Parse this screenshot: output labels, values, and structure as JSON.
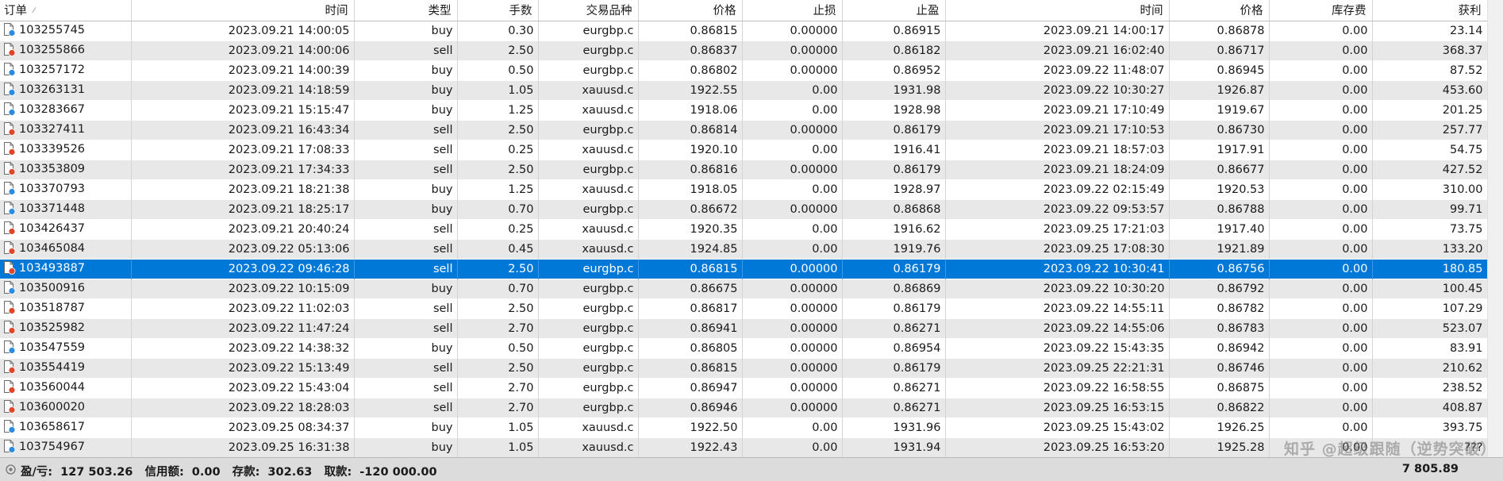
{
  "columns": [
    {
      "key": "order",
      "label": "订单",
      "align": "left",
      "sortable": true
    },
    {
      "key": "open_time",
      "label": "时间",
      "align": "right"
    },
    {
      "key": "type",
      "label": "类型",
      "align": "right"
    },
    {
      "key": "volume",
      "label": "手数",
      "align": "right"
    },
    {
      "key": "symbol",
      "label": "交易品种",
      "align": "right"
    },
    {
      "key": "open_price",
      "label": "价格",
      "align": "right"
    },
    {
      "key": "sl",
      "label": "止损",
      "align": "right"
    },
    {
      "key": "tp",
      "label": "止盈",
      "align": "right"
    },
    {
      "key": "close_time",
      "label": "时间",
      "align": "right"
    },
    {
      "key": "close_price",
      "label": "价格",
      "align": "right"
    },
    {
      "key": "swap",
      "label": "库存费",
      "align": "right"
    },
    {
      "key": "profit",
      "label": "获利",
      "align": "right"
    }
  ],
  "sort_glyph": "⁄",
  "rows": [
    {
      "order": "103255745",
      "open_time": "2023.09.21 14:00:05",
      "type": "buy",
      "volume": "0.30",
      "symbol": "eurgbp.c",
      "open_price": "0.86815",
      "sl": "0.00000",
      "tp": "0.86915",
      "close_time": "2023.09.21 14:00:17",
      "close_price": "0.86878",
      "swap": "0.00",
      "profit": "23.14"
    },
    {
      "order": "103255866",
      "open_time": "2023.09.21 14:00:06",
      "type": "sell",
      "volume": "2.50",
      "symbol": "eurgbp.c",
      "open_price": "0.86837",
      "sl": "0.00000",
      "tp": "0.86182",
      "close_time": "2023.09.21 16:02:40",
      "close_price": "0.86717",
      "swap": "0.00",
      "profit": "368.37"
    },
    {
      "order": "103257172",
      "open_time": "2023.09.21 14:00:39",
      "type": "buy",
      "volume": "0.50",
      "symbol": "eurgbp.c",
      "open_price": "0.86802",
      "sl": "0.00000",
      "tp": "0.86952",
      "close_time": "2023.09.22 11:48:07",
      "close_price": "0.86945",
      "swap": "0.00",
      "profit": "87.52"
    },
    {
      "order": "103263131",
      "open_time": "2023.09.21 14:18:59",
      "type": "buy",
      "volume": "1.05",
      "symbol": "xauusd.c",
      "open_price": "1922.55",
      "sl": "0.00",
      "tp": "1931.98",
      "close_time": "2023.09.22 10:30:27",
      "close_price": "1926.87",
      "swap": "0.00",
      "profit": "453.60"
    },
    {
      "order": "103283667",
      "open_time": "2023.09.21 15:15:47",
      "type": "buy",
      "volume": "1.25",
      "symbol": "xauusd.c",
      "open_price": "1918.06",
      "sl": "0.00",
      "tp": "1928.98",
      "close_time": "2023.09.21 17:10:49",
      "close_price": "1919.67",
      "swap": "0.00",
      "profit": "201.25"
    },
    {
      "order": "103327411",
      "open_time": "2023.09.21 16:43:34",
      "type": "sell",
      "volume": "2.50",
      "symbol": "eurgbp.c",
      "open_price": "0.86814",
      "sl": "0.00000",
      "tp": "0.86179",
      "close_time": "2023.09.21 17:10:53",
      "close_price": "0.86730",
      "swap": "0.00",
      "profit": "257.77"
    },
    {
      "order": "103339526",
      "open_time": "2023.09.21 17:08:33",
      "type": "sell",
      "volume": "0.25",
      "symbol": "xauusd.c",
      "open_price": "1920.10",
      "sl": "0.00",
      "tp": "1916.41",
      "close_time": "2023.09.21 18:57:03",
      "close_price": "1917.91",
      "swap": "0.00",
      "profit": "54.75"
    },
    {
      "order": "103353809",
      "open_time": "2023.09.21 17:34:33",
      "type": "sell",
      "volume": "2.50",
      "symbol": "eurgbp.c",
      "open_price": "0.86816",
      "sl": "0.00000",
      "tp": "0.86179",
      "close_time": "2023.09.21 18:24:09",
      "close_price": "0.86677",
      "swap": "0.00",
      "profit": "427.52"
    },
    {
      "order": "103370793",
      "open_time": "2023.09.21 18:21:38",
      "type": "buy",
      "volume": "1.25",
      "symbol": "xauusd.c",
      "open_price": "1918.05",
      "sl": "0.00",
      "tp": "1928.97",
      "close_time": "2023.09.22 02:15:49",
      "close_price": "1920.53",
      "swap": "0.00",
      "profit": "310.00"
    },
    {
      "order": "103371448",
      "open_time": "2023.09.21 18:25:17",
      "type": "buy",
      "volume": "0.70",
      "symbol": "eurgbp.c",
      "open_price": "0.86672",
      "sl": "0.00000",
      "tp": "0.86868",
      "close_time": "2023.09.22 09:53:57",
      "close_price": "0.86788",
      "swap": "0.00",
      "profit": "99.71"
    },
    {
      "order": "103426437",
      "open_time": "2023.09.21 20:40:24",
      "type": "sell",
      "volume": "0.25",
      "symbol": "xauusd.c",
      "open_price": "1920.35",
      "sl": "0.00",
      "tp": "1916.62",
      "close_time": "2023.09.25 17:21:03",
      "close_price": "1917.40",
      "swap": "0.00",
      "profit": "73.75"
    },
    {
      "order": "103465084",
      "open_time": "2023.09.22 05:13:06",
      "type": "sell",
      "volume": "0.45",
      "symbol": "xauusd.c",
      "open_price": "1924.85",
      "sl": "0.00",
      "tp": "1919.76",
      "close_time": "2023.09.25 17:08:30",
      "close_price": "1921.89",
      "swap": "0.00",
      "profit": "133.20"
    },
    {
      "order": "103493887",
      "open_time": "2023.09.22 09:46:28",
      "type": "sell",
      "volume": "2.50",
      "symbol": "eurgbp.c",
      "open_price": "0.86815",
      "sl": "0.00000",
      "tp": "0.86179",
      "close_time": "2023.09.22 10:30:41",
      "close_price": "0.86756",
      "swap": "0.00",
      "profit": "180.85",
      "selected": true
    },
    {
      "order": "103500916",
      "open_time": "2023.09.22 10:15:09",
      "type": "buy",
      "volume": "0.70",
      "symbol": "eurgbp.c",
      "open_price": "0.86675",
      "sl": "0.00000",
      "tp": "0.86869",
      "close_time": "2023.09.22 10:30:20",
      "close_price": "0.86792",
      "swap": "0.00",
      "profit": "100.45"
    },
    {
      "order": "103518787",
      "open_time": "2023.09.22 11:02:03",
      "type": "sell",
      "volume": "2.50",
      "symbol": "eurgbp.c",
      "open_price": "0.86817",
      "sl": "0.00000",
      "tp": "0.86179",
      "close_time": "2023.09.22 14:55:11",
      "close_price": "0.86782",
      "swap": "0.00",
      "profit": "107.29"
    },
    {
      "order": "103525982",
      "open_time": "2023.09.22 11:47:24",
      "type": "sell",
      "volume": "2.70",
      "symbol": "eurgbp.c",
      "open_price": "0.86941",
      "sl": "0.00000",
      "tp": "0.86271",
      "close_time": "2023.09.22 14:55:06",
      "close_price": "0.86783",
      "swap": "0.00",
      "profit": "523.07"
    },
    {
      "order": "103547559",
      "open_time": "2023.09.22 14:38:32",
      "type": "buy",
      "volume": "0.50",
      "symbol": "eurgbp.c",
      "open_price": "0.86805",
      "sl": "0.00000",
      "tp": "0.86954",
      "close_time": "2023.09.22 15:43:35",
      "close_price": "0.86942",
      "swap": "0.00",
      "profit": "83.91"
    },
    {
      "order": "103554419",
      "open_time": "2023.09.22 15:13:49",
      "type": "sell",
      "volume": "2.50",
      "symbol": "eurgbp.c",
      "open_price": "0.86815",
      "sl": "0.00000",
      "tp": "0.86179",
      "close_time": "2023.09.25 22:21:31",
      "close_price": "0.86746",
      "swap": "0.00",
      "profit": "210.62"
    },
    {
      "order": "103560044",
      "open_time": "2023.09.22 15:43:04",
      "type": "sell",
      "volume": "2.70",
      "symbol": "eurgbp.c",
      "open_price": "0.86947",
      "sl": "0.00000",
      "tp": "0.86271",
      "close_time": "2023.09.22 16:58:55",
      "close_price": "0.86875",
      "swap": "0.00",
      "profit": "238.52"
    },
    {
      "order": "103600020",
      "open_time": "2023.09.22 18:28:03",
      "type": "sell",
      "volume": "2.70",
      "symbol": "eurgbp.c",
      "open_price": "0.86946",
      "sl": "0.00000",
      "tp": "0.86271",
      "close_time": "2023.09.25 16:53:15",
      "close_price": "0.86822",
      "swap": "0.00",
      "profit": "408.87"
    },
    {
      "order": "103658617",
      "open_time": "2023.09.25 08:34:37",
      "type": "buy",
      "volume": "1.05",
      "symbol": "xauusd.c",
      "open_price": "1922.50",
      "sl": "0.00",
      "tp": "1931.96",
      "close_time": "2023.09.25 15:43:02",
      "close_price": "1926.25",
      "swap": "0.00",
      "profit": "393.75"
    },
    {
      "order": "103754967",
      "open_time": "2023.09.25 16:31:38",
      "type": "buy",
      "volume": "1.05",
      "symbol": "xauusd.c",
      "open_price": "1922.43",
      "sl": "0.00",
      "tp": "1931.94",
      "close_time": "2023.09.25 16:53:20",
      "close_price": "1925.28",
      "swap": "0.00",
      "profit": "???"
    }
  ],
  "footer": {
    "pl_label": "盈/亏:",
    "pl_value": "127 503.26",
    "credit_label": "信用额:",
    "credit_value": "0.00",
    "deposit_label": "存款:",
    "deposit_value": "302.63",
    "withdraw_label": "取款:",
    "withdraw_value": "-120 000.00",
    "total": "7 805.89"
  },
  "watermark": "知乎 @超级跟随（逆势突破）",
  "colors": {
    "selected_row": "#0078d7",
    "alt_row": "#e8e8e8",
    "buy_icon": "#2a8be0",
    "sell_icon": "#e0452a"
  }
}
